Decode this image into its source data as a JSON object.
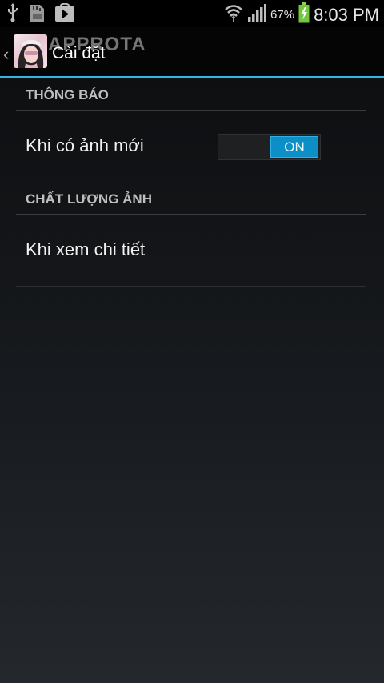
{
  "status_bar": {
    "left_icons": [
      "usb-icon",
      "sd-card-icon",
      "play-store-icon"
    ],
    "battery_percent": "67%",
    "time": "8:03 PM",
    "right_icons": [
      "wifi-icon",
      "signal-icon",
      "battery-charging-icon"
    ]
  },
  "action_bar": {
    "title": "Cài đặt",
    "watermark": "APPROTA",
    "up_icon": "chevron-left-icon",
    "accent_color": "#33b5e5"
  },
  "sections": [
    {
      "header": "THÔNG BÁO",
      "items": [
        {
          "title": "Khi có ảnh mới",
          "toggle_label": "ON",
          "toggle_state": "on"
        }
      ]
    },
    {
      "header": "CHẤT LƯỢNG ẢNH",
      "items": [
        {
          "title": "Khi xem chi tiết"
        }
      ]
    }
  ]
}
